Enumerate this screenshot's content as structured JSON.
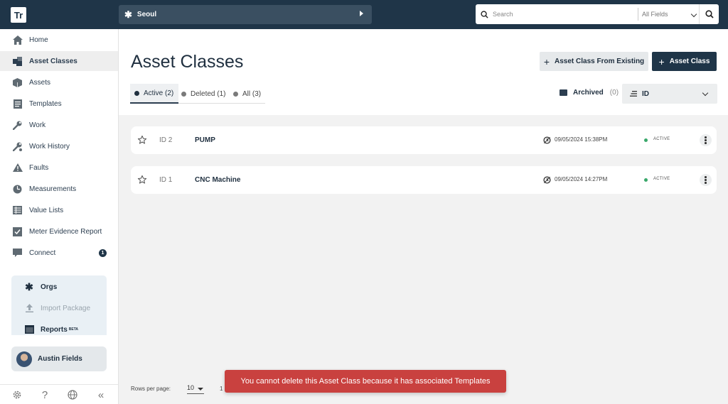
{
  "app": {
    "logo_text": "Tr"
  },
  "org_switcher": {
    "name": "Seoul"
  },
  "search": {
    "placeholder": "Search",
    "field_filter": "All Fields"
  },
  "sidebar": {
    "items": [
      {
        "label": "Home",
        "icon": "home-icon"
      },
      {
        "label": "Asset Classes",
        "icon": "asset-classes-icon",
        "active": true
      },
      {
        "label": "Assets",
        "icon": "box-icon"
      },
      {
        "label": "Templates",
        "icon": "template-icon"
      },
      {
        "label": "Work",
        "icon": "wrench-icon"
      },
      {
        "label": "Work History",
        "icon": "wrench-history-icon"
      },
      {
        "label": "Faults",
        "icon": "warning-icon"
      },
      {
        "label": "Measurements",
        "icon": "chart-pie-icon"
      },
      {
        "label": "Value Lists",
        "icon": "list-icon"
      },
      {
        "label": "Meter Evidence Report",
        "icon": "check-box-icon"
      },
      {
        "label": "Connect",
        "icon": "chat-icon",
        "badge": "1"
      }
    ],
    "admin": [
      {
        "label": "Orgs",
        "icon": "orgs-icon"
      },
      {
        "label": "Import Package",
        "icon": "upload-icon",
        "disabled": true
      },
      {
        "label": "Reports",
        "icon": "reports-icon",
        "sup": "BETA"
      }
    ],
    "user": {
      "name": "Austin Fields"
    },
    "footer_icons": [
      "settings-icon",
      "help-icon",
      "globe-icon",
      "collapse-icon"
    ]
  },
  "main": {
    "title": "Asset Classes",
    "buttons": {
      "from_existing": "Asset Class From Existing",
      "new": "Asset Class"
    },
    "tabs": [
      {
        "label": "Active (2)",
        "active": true
      },
      {
        "label": "Deleted (1)"
      },
      {
        "label": "All (3)"
      }
    ],
    "archived": {
      "label": "Archived",
      "count": "(0)"
    },
    "sort": {
      "value": "ID"
    },
    "rows": [
      {
        "id": "ID 2",
        "name": "PUMP",
        "date": "09/05/2024 15:38PM",
        "status": "ACTIVE"
      },
      {
        "id": "ID 1",
        "name": "CNC Machine",
        "date": "09/05/2024 14:27PM",
        "status": "ACTIVE"
      }
    ],
    "pagination": {
      "rows_label": "Rows per page:",
      "rows_value": "10",
      "range": "1"
    }
  },
  "toast": {
    "message": "You cannot delete this Asset Class because it has associated Templates"
  },
  "colors": {
    "topbar": "#1f3548",
    "primary": "#1f3548",
    "toast": "#c9413f",
    "status_active": "#3aa86b"
  }
}
